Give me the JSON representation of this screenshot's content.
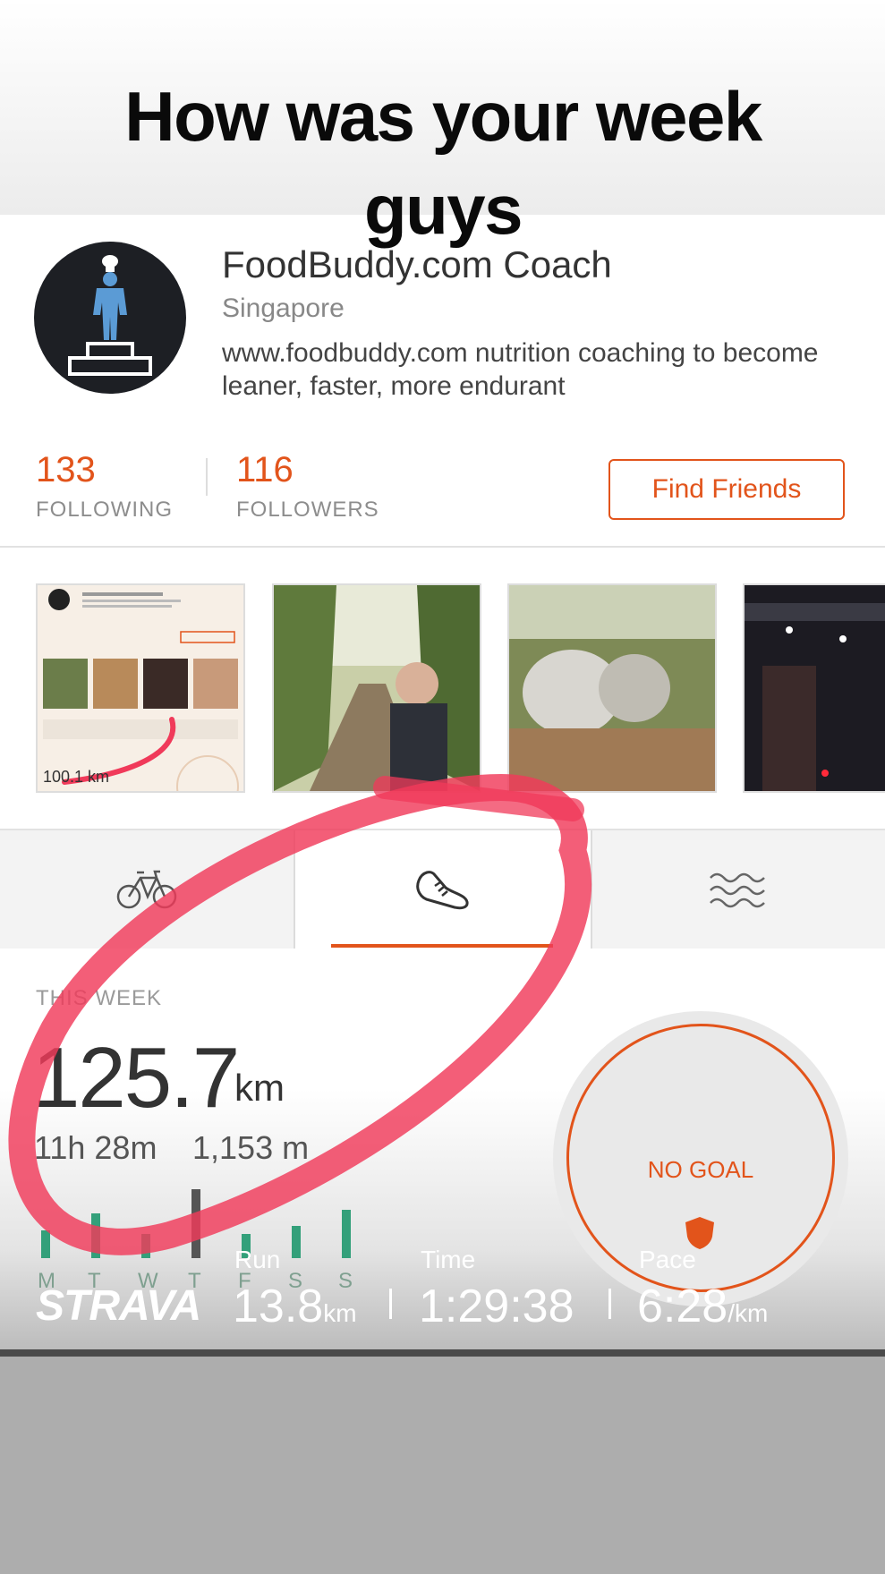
{
  "story": {
    "caption": "How was your week guys"
  },
  "profile": {
    "name": "FoodBuddy.com Coach",
    "location": "Singapore",
    "bio": "www.foodbuddy.com nutrition coaching to become leaner, faster, more endurant"
  },
  "stats": {
    "following_count": "133",
    "following_label": "FOLLOWING",
    "followers_count": "116",
    "followers_label": "FOLLOWERS",
    "find_friends_label": "Find Friends"
  },
  "photos": {
    "first_thumb_text": "100.1 km"
  },
  "tabs": [
    {
      "icon": "bike-icon"
    },
    {
      "icon": "running-shoe-icon"
    },
    {
      "icon": "water-waves-icon"
    }
  ],
  "week": {
    "heading": "THIS WEEK",
    "distance": "125.7",
    "distance_unit": "km",
    "time": "11h 28m",
    "elevation": "1,153 m",
    "days": [
      "M",
      "T",
      "W",
      "T",
      "F",
      "S",
      "S"
    ],
    "day_bar_levels": [
      0.35,
      0.55,
      0.3,
      0.85,
      0.3,
      0.4,
      0.6
    ],
    "goal_text": "NO GOAL"
  },
  "overlay": {
    "brand": "STRAVA",
    "run_label": "Run",
    "run_value": "13.8",
    "run_unit": "km",
    "time_label": "Time",
    "time_value": "1:29:38",
    "pace_label": "Pace",
    "pace_value": "6:28",
    "pace_unit": "/km"
  },
  "colors": {
    "accent": "#e2541b",
    "bars": "#33a07a",
    "scribble": "#f03a5a"
  }
}
